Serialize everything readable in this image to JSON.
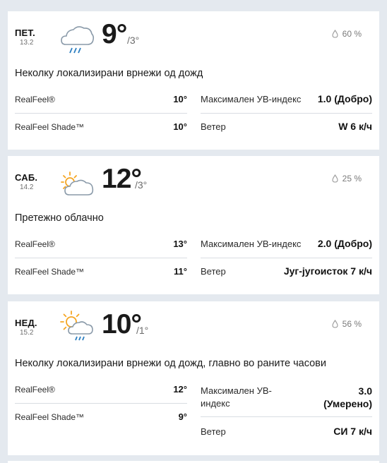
{
  "days": [
    {
      "dow": "ПЕТ.",
      "date": "13.2",
      "icon": "cloud-rain-icon",
      "temp": "9°",
      "low": "/3°",
      "precip": "60 %",
      "phrase": "Неколку локализирани врнежи од дожд",
      "realfeel_label": "RealFeel®",
      "realfeel": "10°",
      "realfeel_shade_label": "RealFeel Shade™",
      "realfeel_shade": "10°",
      "uv_label": "Максимален УВ-индекс",
      "uv": "1.0 (Добро)",
      "wind_label": "Ветер",
      "wind": "W 6 к/ч"
    },
    {
      "dow": "САБ.",
      "date": "14.2",
      "icon": "sun-cloud-icon",
      "temp": "12°",
      "low": "/3°",
      "precip": "25 %",
      "phrase": "Претежно облачно",
      "realfeel_label": "RealFeel®",
      "realfeel": "13°",
      "realfeel_shade_label": "RealFeel Shade™",
      "realfeel_shade": "11°",
      "uv_label": "Максимален УВ-индекс",
      "uv": "2.0 (Добро)",
      "wind_label": "Ветер",
      "wind": "Југ-југоисток 7 к/ч"
    },
    {
      "dow": "НЕД.",
      "date": "15.2",
      "icon": "sun-cloud-rain-icon",
      "temp": "10°",
      "low": "/1°",
      "precip": "56 %",
      "phrase": "Неколку локализирани врнежи од дожд, главно во раните часови",
      "realfeel_label": "RealFeel®",
      "realfeel": "12°",
      "realfeel_shade_label": "RealFeel Shade™",
      "realfeel_shade": "9°",
      "uv_label_line1": "Максимален УВ-",
      "uv_label_line2": "индекс",
      "uv_line1": "3.0",
      "uv_line2": "(Умерено)",
      "wind_label": "Ветер",
      "wind": "СИ 7 к/ч"
    }
  ],
  "colors": {
    "background": "#e4e9ef",
    "card": "#ffffff",
    "sun": "#f5a623",
    "rain": "#2d7fc1",
    "cloud": "#8a9aa9"
  }
}
